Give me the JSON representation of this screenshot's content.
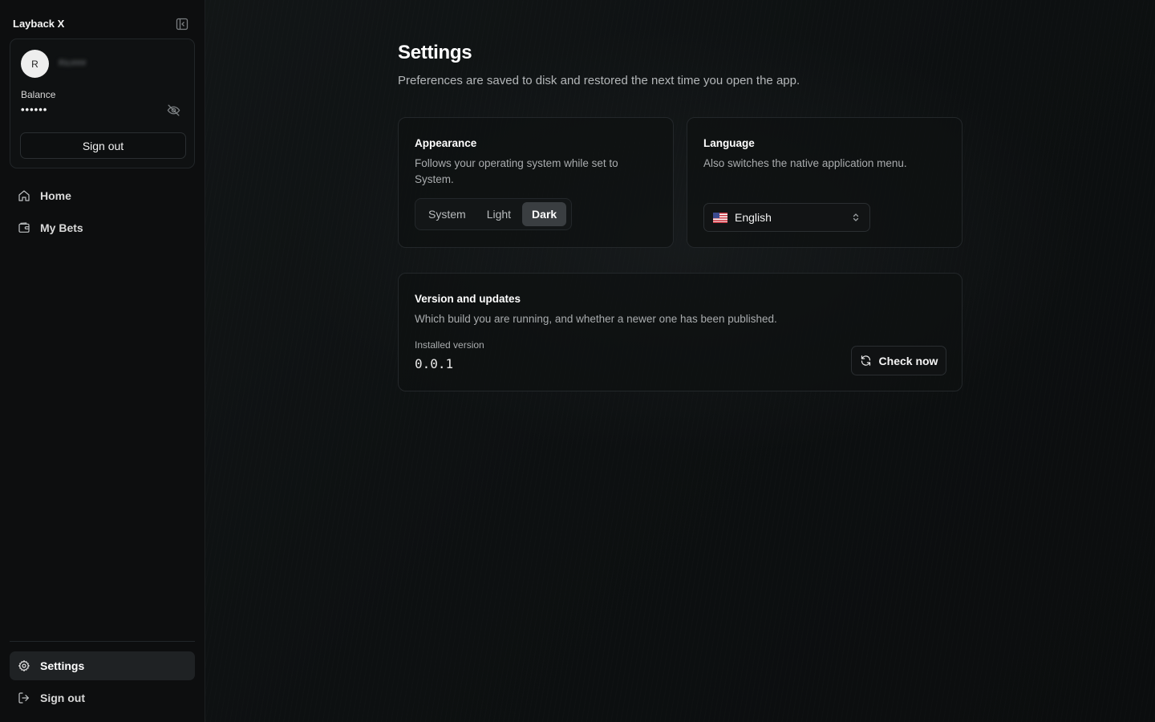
{
  "sidebar": {
    "brand": "Layback X",
    "account": {
      "avatar_initial": "R",
      "username": "Ric###",
      "balance_label": "Balance",
      "balance_value": "••••••",
      "signout_label": "Sign out"
    },
    "nav": [
      {
        "label": "Home",
        "icon": "home-icon"
      },
      {
        "label": "My Bets",
        "icon": "wallet-icon"
      }
    ],
    "bottom": [
      {
        "label": "Settings",
        "icon": "gear-icon",
        "active": true
      },
      {
        "label": "Sign out",
        "icon": "logout-icon"
      }
    ]
  },
  "main": {
    "title": "Settings",
    "subtitle": "Preferences are saved to disk and restored the next time you open the app.",
    "appearance": {
      "title": "Appearance",
      "description": "Follows your operating system while set to System.",
      "options": [
        "System",
        "Light",
        "Dark"
      ],
      "selected": "Dark"
    },
    "language": {
      "title": "Language",
      "description": "Also switches the native application menu.",
      "selected": "English",
      "flag_icon": "us-flag-icon"
    },
    "version": {
      "title": "Version and updates",
      "description": "Which build you are running, and whether a newer one has been published.",
      "installed_label": "Installed version",
      "installed_value": "0.0.1",
      "check_label": "Check now"
    }
  },
  "colors": {
    "background": "#0d1011",
    "sidebar": "#0d0e0f",
    "card_border": "#23272a",
    "active_segment": "#3a3e41",
    "active_nav": "#1f2224"
  }
}
